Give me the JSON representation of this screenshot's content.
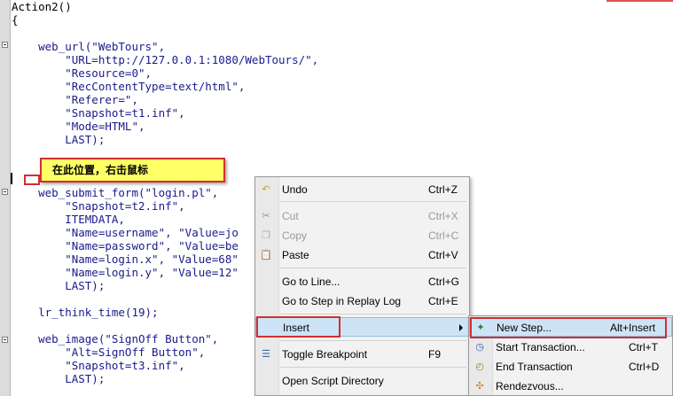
{
  "code_lines": [
    "Action2()",
    "{",
    "",
    "    web_url(\"WebTours\",",
    "        \"URL=http://127.0.0.1:1080/WebTours/\",",
    "        \"Resource=0\",",
    "        \"RecContentType=text/html\",",
    "        \"Referer=\",",
    "        \"Snapshot=t1.inf\",",
    "        \"Mode=HTML\",",
    "        LAST);",
    "",
    "",
    "",
    "    web_submit_form(\"login.pl\",",
    "        \"Snapshot=t2.inf\",",
    "        ITEMDATA,",
    "        \"Name=username\", \"Value=jo",
    "        \"Name=password\", \"Value=be",
    "        \"Name=login.x\", \"Value=68\"",
    "        \"Name=login.y\", \"Value=12\"",
    "        LAST);",
    "",
    "    lr_think_time(19);",
    "",
    "    web_image(\"SignOff Button\",",
    "        \"Alt=SignOff Button\",",
    "        \"Snapshot=t3.inf\",",
    "        LAST);"
  ],
  "callout": {
    "text": "在此位置，右击鼠标"
  },
  "context_menu": {
    "items": [
      {
        "label": "Undo",
        "underline": "U",
        "shortcut": "Ctrl+Z",
        "icon": "undo-icon",
        "disabled": false
      },
      {
        "label": "Cut",
        "underline": "t",
        "shortcut": "Ctrl+X",
        "icon": "cut-icon",
        "disabled": true
      },
      {
        "label": "Copy",
        "underline": "C",
        "shortcut": "Ctrl+C",
        "icon": "copy-icon",
        "disabled": true
      },
      {
        "label": "Paste",
        "underline": "P",
        "shortcut": "Ctrl+V",
        "icon": "paste-icon",
        "disabled": false
      },
      {
        "label": "Go to Line...",
        "underline": "L",
        "shortcut": "Ctrl+G",
        "icon": "",
        "disabled": false
      },
      {
        "label": "Go to Step in Replay Log",
        "underline": "S",
        "shortcut": "Ctrl+E",
        "icon": "",
        "disabled": false
      },
      {
        "label": "Insert",
        "underline": "I",
        "shortcut": "",
        "icon": "",
        "disabled": false,
        "highlighted": true,
        "has_submenu": true
      },
      {
        "label": "Toggle Breakpoint",
        "underline": "T",
        "shortcut": "F9",
        "icon": "breakpoint-icon",
        "disabled": false
      },
      {
        "label": "Open Script Directory",
        "underline": "",
        "shortcut": "",
        "icon": "",
        "disabled": false
      }
    ]
  },
  "insert_submenu": {
    "items": [
      {
        "label": "New Step...",
        "underline": "N",
        "shortcut": "Alt+Insert",
        "icon": "new-step-icon",
        "highlighted": true
      },
      {
        "label": "Start Transaction...",
        "underline": "S",
        "shortcut": "Ctrl+T",
        "icon": "start-transaction-icon"
      },
      {
        "label": "End Transaction",
        "underline": "E",
        "shortcut": "Ctrl+D",
        "icon": "end-transaction-icon"
      },
      {
        "label": "Rendezvous...",
        "underline": "R",
        "shortcut": "",
        "icon": "rendezvous-icon"
      }
    ]
  },
  "colors": {
    "code_text": "#1a1a8c",
    "callout_bg": "#ffff66",
    "annotation_red": "#d22f2f",
    "menu_highlight": "#cde4f7"
  }
}
